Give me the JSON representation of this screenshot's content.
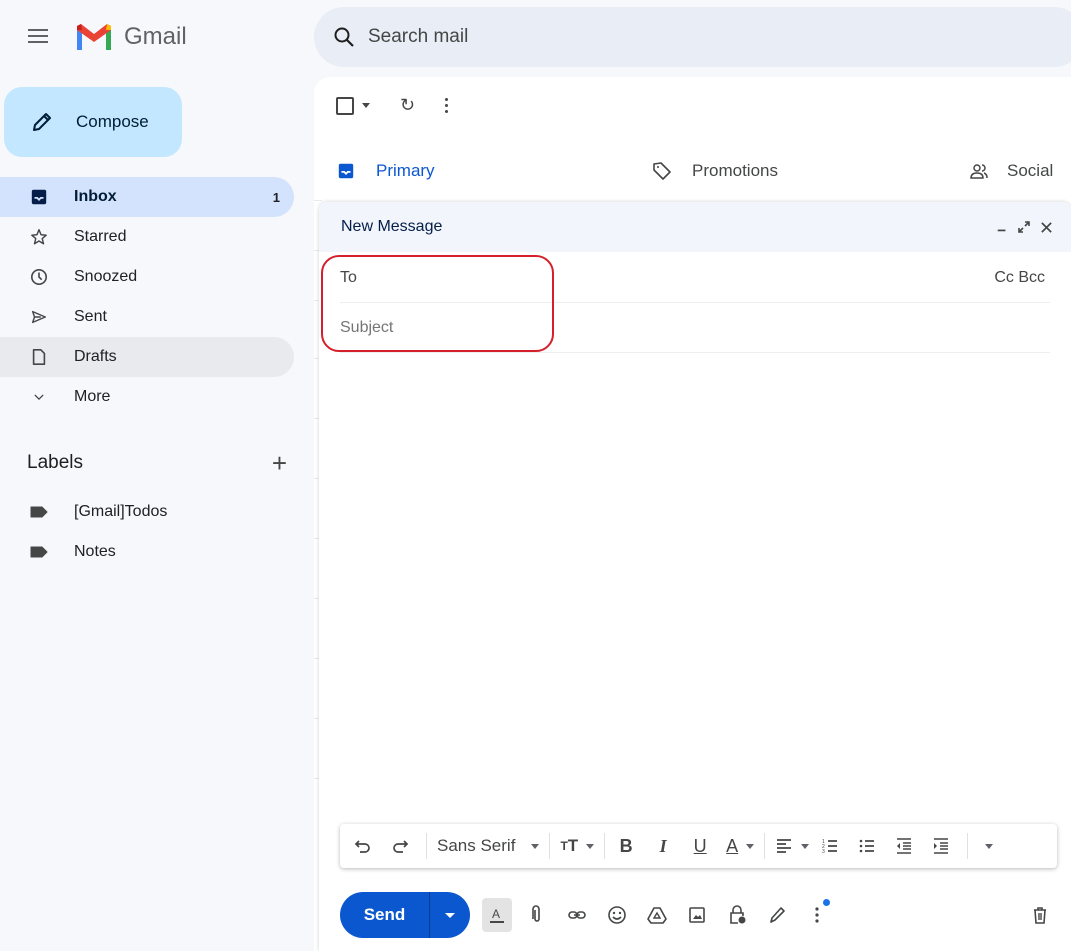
{
  "app": {
    "name": "Gmail",
    "brand_colors": {
      "red": "#ea4335",
      "blue": "#4285f4",
      "green": "#34a853",
      "yellow": "#fbbc04"
    }
  },
  "search": {
    "placeholder": "Search mail",
    "value": ""
  },
  "sidebar": {
    "compose_label": "Compose",
    "items": [
      {
        "label": "Inbox",
        "icon": "inbox-icon",
        "count": "1",
        "active": true
      },
      {
        "label": "Starred",
        "icon": "star-icon",
        "count": ""
      },
      {
        "label": "Snoozed",
        "icon": "clock-icon",
        "count": ""
      },
      {
        "label": "Sent",
        "icon": "send-icon",
        "count": ""
      },
      {
        "label": "Drafts",
        "icon": "draft-icon",
        "count": ""
      },
      {
        "label": "More",
        "icon": "chevron-down-icon",
        "count": ""
      }
    ],
    "labels_header": "Labels",
    "labels": [
      {
        "label": "[Gmail]Todos",
        "icon": "label-icon"
      },
      {
        "label": "Notes",
        "icon": "label-icon"
      }
    ]
  },
  "mail": {
    "tabs": [
      {
        "label": "Primary",
        "icon": "inbox-icon",
        "active": true
      },
      {
        "label": "Promotions",
        "icon": "tag-icon"
      },
      {
        "label": "Social",
        "icon": "people-icon"
      }
    ]
  },
  "compose": {
    "title": "New Message",
    "to_label": "To",
    "to_value": "",
    "cc_bcc": "Cc Bcc",
    "subject_placeholder": "Subject",
    "subject_value": "",
    "body_value": "",
    "font_family": "Sans Serif",
    "send_label": "Send",
    "annotation_color": "#d5202b"
  }
}
